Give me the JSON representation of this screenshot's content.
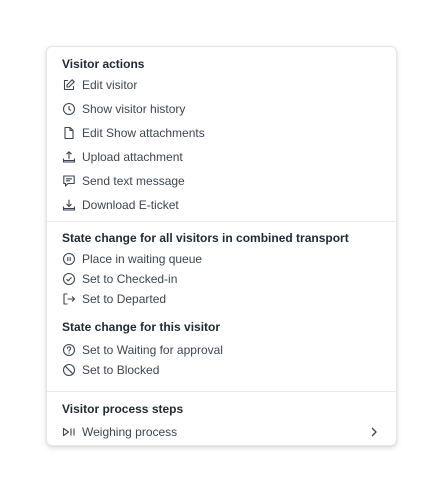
{
  "visitor_actions": {
    "heading": "Visitor actions",
    "items": [
      {
        "label": "Edit visitor",
        "icon": "edit-icon"
      },
      {
        "label": "Show visitor history",
        "icon": "clock-icon"
      },
      {
        "label": "Edit Show attachments",
        "icon": "file-icon"
      },
      {
        "label": "Upload attachment",
        "icon": "upload-icon"
      },
      {
        "label": "Send text message",
        "icon": "message-icon"
      },
      {
        "label": "Download E-ticket",
        "icon": "download-icon"
      }
    ]
  },
  "combined_transport": {
    "heading": "State change for all visitors in combined transport",
    "items": [
      {
        "label": "Place in waiting queue",
        "icon": "pause-circle-icon"
      },
      {
        "label": "Set to Checked-in",
        "icon": "check-circle-icon"
      },
      {
        "label": "Set to Departed",
        "icon": "logout-icon"
      }
    ]
  },
  "this_visitor": {
    "heading": "State change for this visitor",
    "items": [
      {
        "label": "Set to Waiting for approval",
        "icon": "question-circle-icon"
      },
      {
        "label": "Set to Blocked",
        "icon": "blocked-icon"
      }
    ]
  },
  "process_steps": {
    "heading": "Visitor process steps",
    "items": [
      {
        "label": "Weighing process",
        "icon": "step-icon",
        "submenu": "chevron-right-icon"
      }
    ]
  }
}
